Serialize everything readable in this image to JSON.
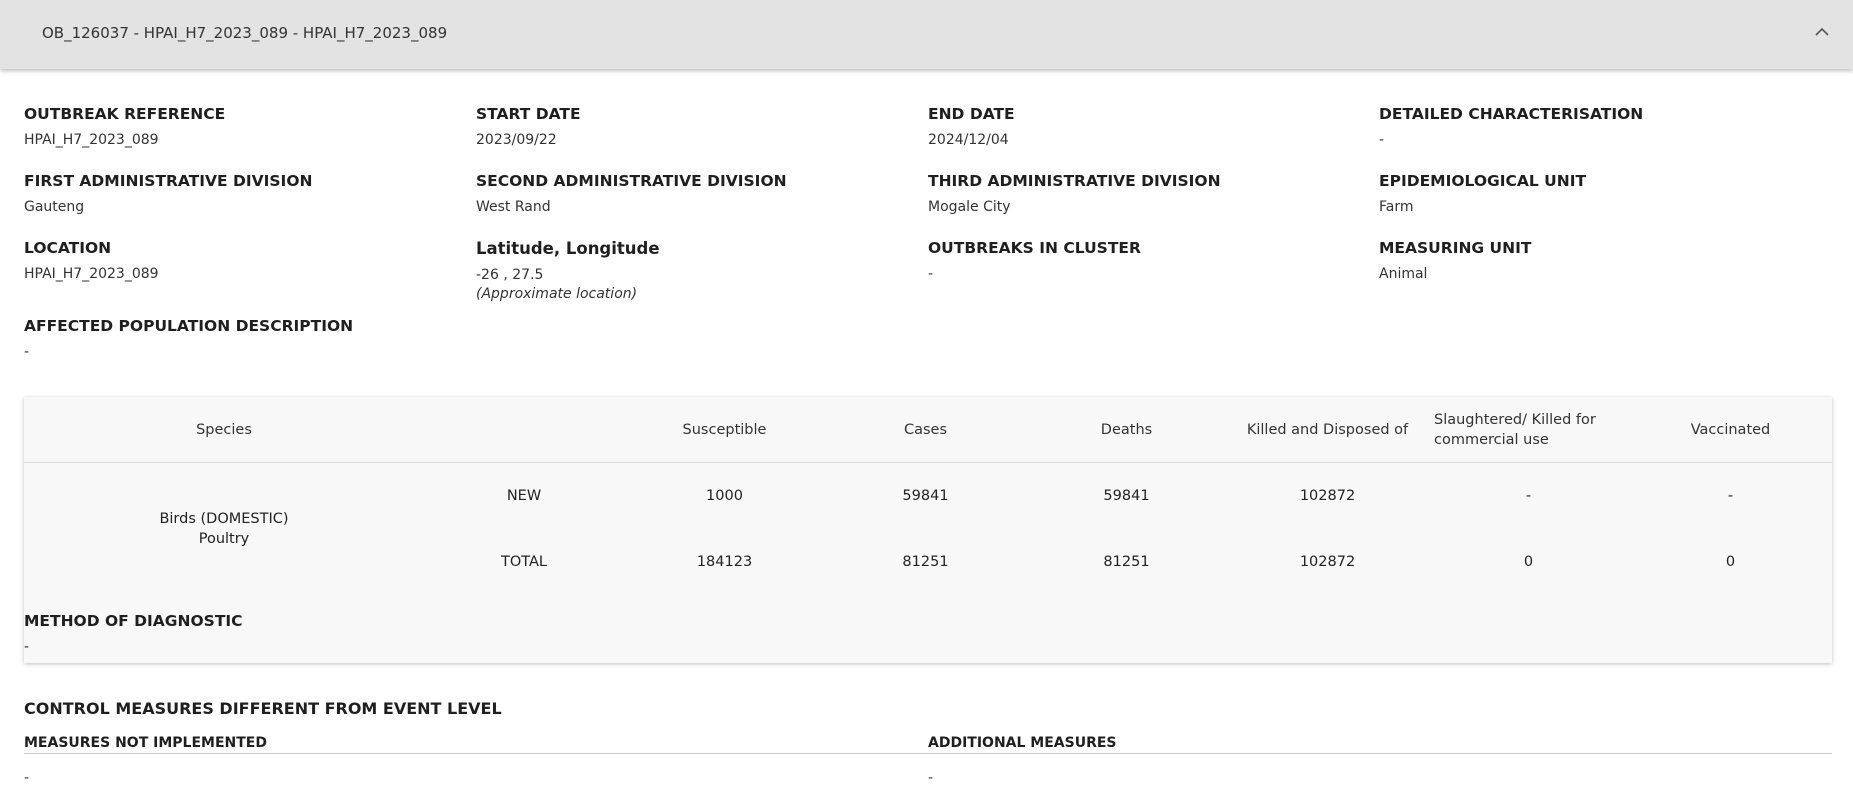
{
  "header": {
    "title": "OB_126037 - HPAI_H7_2023_089 - HPAI_H7_2023_089",
    "collapse_icon": "chevron-up-icon"
  },
  "fields": {
    "outbreak_reference": {
      "label": "OUTBREAK REFERENCE",
      "value": "HPAI_H7_2023_089"
    },
    "start_date": {
      "label": "START DATE",
      "value": "2023/09/22"
    },
    "end_date": {
      "label": "END DATE",
      "value": "2024/12/04"
    },
    "detailed_characterisation": {
      "label": "DETAILED CHARACTERISATION",
      "value": "-"
    },
    "first_admin_division": {
      "label": "FIRST ADMINISTRATIVE DIVISION",
      "value": "Gauteng"
    },
    "second_admin_division": {
      "label": "SECOND ADMINISTRATIVE DIVISION",
      "value": "West Rand"
    },
    "third_admin_division": {
      "label": "THIRD ADMINISTRATIVE DIVISION",
      "value": "Mogale City"
    },
    "epidemiological_unit": {
      "label": "EPIDEMIOLOGICAL UNIT",
      "value": "Farm"
    },
    "location": {
      "label": "LOCATION",
      "value": "HPAI_H7_2023_089"
    },
    "lat_long": {
      "label": "Latitude, Longitude",
      "value": "-26 , 27.5",
      "note": "(Approximate location)"
    },
    "outbreaks_in_cluster": {
      "label": "OUTBREAKS IN CLUSTER",
      "value": "-"
    },
    "measuring_unit": {
      "label": "MEASURING UNIT",
      "value": "Animal"
    },
    "affected_population": {
      "label": "AFFECTED POPULATION DESCRIPTION",
      "value": "-"
    }
  },
  "table": {
    "headers": {
      "species": "Species",
      "susceptible": "Susceptible",
      "cases": "Cases",
      "deaths": "Deaths",
      "killed": "Killed and Disposed of",
      "slaughtered": "Slaughtered/ Killed for commercial use",
      "vaccinated": "Vaccinated"
    },
    "species_line1": "Birds (DOMESTIC)",
    "species_line2": "Poultry",
    "rows": [
      {
        "type": "NEW",
        "susceptible": "1000",
        "cases": "59841",
        "deaths": "59841",
        "killed": "102872",
        "slaughtered": "-",
        "vaccinated": "-"
      },
      {
        "type": "TOTAL",
        "susceptible": "184123",
        "cases": "81251",
        "deaths": "81251",
        "killed": "102872",
        "slaughtered": "0",
        "vaccinated": "0"
      }
    ]
  },
  "method_of_diagnostic": {
    "label": "METHOD OF DIAGNOSTIC",
    "value": "-"
  },
  "control_measures": {
    "title": "CONTROL MEASURES DIFFERENT FROM EVENT LEVEL",
    "not_implemented_label": "MEASURES NOT IMPLEMENTED",
    "not_implemented_value": "-",
    "additional_label": "ADDITIONAL MEASURES",
    "additional_value": "-"
  }
}
